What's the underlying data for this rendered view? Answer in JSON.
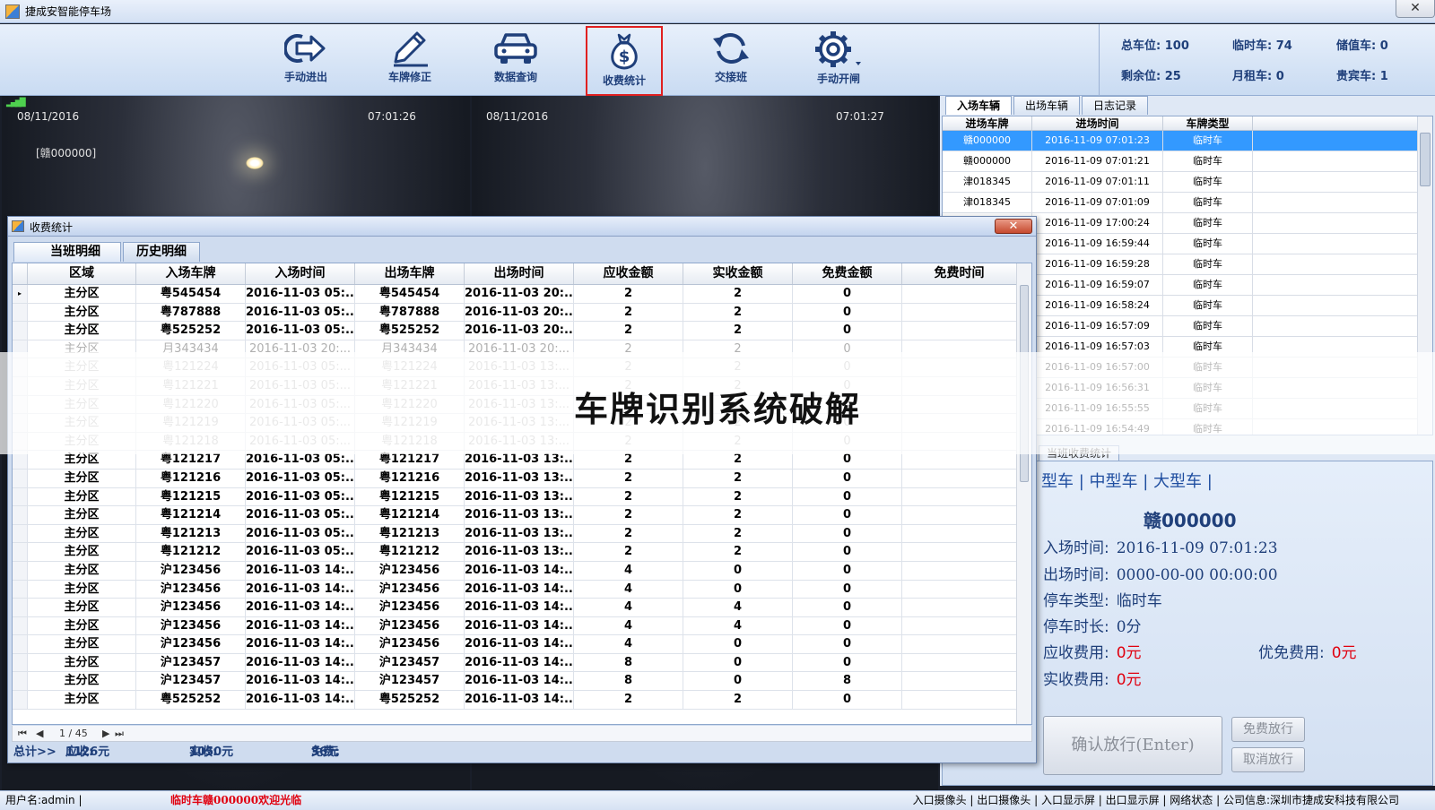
{
  "window": {
    "title": "捷成安智能停车场",
    "close": "✕"
  },
  "toolbar": {
    "buttons": [
      {
        "label": "手动进出",
        "icon": "enter-arrow-icon"
      },
      {
        "label": "车牌修正",
        "icon": "pencil-icon"
      },
      {
        "label": "数据查询",
        "icon": "car-icon"
      },
      {
        "label": "收费统计",
        "icon": "money-bag-icon",
        "active": true
      },
      {
        "label": "交接班",
        "icon": "refresh-icon"
      },
      {
        "label": "手动开闸",
        "icon": "gear-icon"
      }
    ],
    "stats": {
      "total_label": "总车位:",
      "total": "100",
      "temp_label": "临时车:",
      "temp": "74",
      "stored_label": "储值车:",
      "stored": "0",
      "remain_label": "剩余位:",
      "remain": "25",
      "monthly_label": "月租车:",
      "monthly": "0",
      "vip_label": "贵宾车:",
      "vip": "1"
    }
  },
  "cameras": [
    {
      "date": "08/11/2016",
      "time": "07:01:26",
      "plate": "[赣000000]"
    },
    {
      "date": "08/11/2016",
      "time": "07:01:27"
    }
  ],
  "right_panel": {
    "tabs": [
      "入场车辆",
      "出场车辆",
      "日志记录"
    ],
    "columns": [
      "进场车牌",
      "进场时间",
      "车牌类型"
    ],
    "rows": [
      [
        "赣000000",
        "2016-11-09 07:01:23",
        "临时车"
      ],
      [
        "赣000000",
        "2016-11-09 07:01:21",
        "临时车"
      ],
      [
        "津018345",
        "2016-11-09 07:01:11",
        "临时车"
      ],
      [
        "津018345",
        "2016-11-09 07:01:09",
        "临时车"
      ],
      [
        "",
        "2016-11-09 17:00:24",
        "临时车"
      ],
      [
        "",
        "2016-11-09 16:59:44",
        "临时车"
      ],
      [
        "",
        "2016-11-09 16:59:28",
        "临时车"
      ],
      [
        "",
        "2016-11-09 16:59:07",
        "临时车"
      ],
      [
        "",
        "2016-11-09 16:58:24",
        "临时车"
      ],
      [
        "",
        "2016-11-09 16:57:09",
        "临时车"
      ],
      [
        "",
        "2016-11-09 16:57:03",
        "临时车"
      ],
      [
        "",
        "2016-11-09 16:57:00",
        "临时车"
      ],
      [
        "",
        "2016-11-09 16:56:31",
        "临时车"
      ],
      [
        "",
        "2016-11-09 16:55:55",
        "临时车"
      ],
      [
        "",
        "2016-11-09 16:54:49",
        "临时车"
      ]
    ],
    "sub_tab": "当班收费统计",
    "vehicle_types": "型车 | 中型车 | 大型车 |",
    "plate": "赣000000",
    "entry_label": "入场时间:",
    "entry": "2016-11-09 07:01:23",
    "exit_label": "出场时间:",
    "exit": "0000-00-00 00:00:00",
    "type_label": "停车类型:",
    "type": "临时车",
    "duration_label": "停车时长:",
    "duration": "0分",
    "due_label": "应收费用:",
    "due": "0元",
    "discount_label": "优免费用:",
    "discount": "0元",
    "paid_label": "实收费用:",
    "paid": "0元",
    "confirm_button": "确认放行(Enter)",
    "free_button": "免费放行",
    "cancel_button": "取消放行"
  },
  "dialog": {
    "title": "收费统计",
    "tabs": [
      "当班明细",
      "历史明细"
    ],
    "columns": [
      "区域",
      "入场车牌",
      "入场时间",
      "出场车牌",
      "出场时间",
      "应收金额",
      "实收金额",
      "免费金额",
      "免费时间"
    ],
    "rows": [
      [
        "主分区",
        "粤545454",
        "2016-11-03 05:...",
        "粤545454",
        "2016-11-03 20:...",
        "2",
        "2",
        "0",
        ""
      ],
      [
        "主分区",
        "粤787888",
        "2016-11-03 05:...",
        "粤787888",
        "2016-11-03 20:...",
        "2",
        "2",
        "0",
        ""
      ],
      [
        "主分区",
        "粤525252",
        "2016-11-03 05:...",
        "粤525252",
        "2016-11-03 20:...",
        "2",
        "2",
        "0",
        ""
      ],
      [
        "主分区",
        "月343434",
        "2016-11-03 20:...",
        "月343434",
        "2016-11-03 20:...",
        "2",
        "2",
        "0",
        ""
      ],
      [
        "主分区",
        "粤121224",
        "2016-11-03 05:...",
        "粤121224",
        "2016-11-03 13:...",
        "2",
        "2",
        "0",
        ""
      ],
      [
        "主分区",
        "粤121221",
        "2016-11-03 05:...",
        "粤121221",
        "2016-11-03 13:...",
        "2",
        "2",
        "0",
        ""
      ],
      [
        "主分区",
        "粤121220",
        "2016-11-03 05:...",
        "粤121220",
        "2016-11-03 13:...",
        "2",
        "2",
        "0",
        ""
      ],
      [
        "主分区",
        "粤121219",
        "2016-11-03 05:...",
        "粤121219",
        "2016-11-03 13:...",
        "2",
        "2",
        "0",
        ""
      ],
      [
        "主分区",
        "粤121218",
        "2016-11-03 05:...",
        "粤121218",
        "2016-11-03 13:...",
        "2",
        "2",
        "0",
        ""
      ],
      [
        "主分区",
        "粤121217",
        "2016-11-03 05:...",
        "粤121217",
        "2016-11-03 13:...",
        "2",
        "2",
        "0",
        ""
      ],
      [
        "主分区",
        "粤121216",
        "2016-11-03 05:...",
        "粤121216",
        "2016-11-03 13:...",
        "2",
        "2",
        "0",
        ""
      ],
      [
        "主分区",
        "粤121215",
        "2016-11-03 05:...",
        "粤121215",
        "2016-11-03 13:...",
        "2",
        "2",
        "0",
        ""
      ],
      [
        "主分区",
        "粤121214",
        "2016-11-03 05:...",
        "粤121214",
        "2016-11-03 13:...",
        "2",
        "2",
        "0",
        ""
      ],
      [
        "主分区",
        "粤121213",
        "2016-11-03 05:...",
        "粤121213",
        "2016-11-03 13:...",
        "2",
        "2",
        "0",
        ""
      ],
      [
        "主分区",
        "粤121212",
        "2016-11-03 05:...",
        "粤121212",
        "2016-11-03 13:...",
        "2",
        "2",
        "0",
        ""
      ],
      [
        "主分区",
        "沪123456",
        "2016-11-03 14:...",
        "沪123456",
        "2016-11-03 14:...",
        "4",
        "0",
        "0",
        ""
      ],
      [
        "主分区",
        "沪123456",
        "2016-11-03 14:...",
        "沪123456",
        "2016-11-03 14:...",
        "4",
        "0",
        "0",
        ""
      ],
      [
        "主分区",
        "沪123456",
        "2016-11-03 14:...",
        "沪123456",
        "2016-11-03 14:...",
        "4",
        "4",
        "0",
        ""
      ],
      [
        "主分区",
        "沪123456",
        "2016-11-03 14:...",
        "沪123456",
        "2016-11-03 14:...",
        "4",
        "4",
        "0",
        ""
      ],
      [
        "主分区",
        "沪123456",
        "2016-11-03 14:...",
        "沪123456",
        "2016-11-03 14:...",
        "4",
        "0",
        "0",
        ""
      ],
      [
        "主分区",
        "沪123457",
        "2016-11-03 14:...",
        "沪123457",
        "2016-11-03 14:...",
        "8",
        "0",
        "0",
        ""
      ],
      [
        "主分区",
        "沪123457",
        "2016-11-03 14:...",
        "沪123457",
        "2016-11-03 14:...",
        "8",
        "0",
        "8",
        ""
      ],
      [
        "主分区",
        "粤525252",
        "2016-11-03 14:...",
        "粤525252",
        "2016-11-03 14:...",
        "2",
        "2",
        "0",
        ""
      ]
    ],
    "pager": "1 / 45",
    "totals": {
      "label": "总计>>",
      "due_label": "应收:",
      "due": "1126元",
      "paid_label": "实收:",
      "paid": "1050元",
      "free_label": "免费:",
      "free": "36元"
    }
  },
  "statusbar": {
    "user": "用户名:admin  |",
    "message": "临时车赣000000欢迎光临",
    "right": "入口摄像头 | 出口摄像头 | 入口显示屏 | 出口显示屏 | 网络状态 | 公司信息:深圳市捷成安科技有限公司"
  },
  "watermark": "车牌识别系统破解"
}
